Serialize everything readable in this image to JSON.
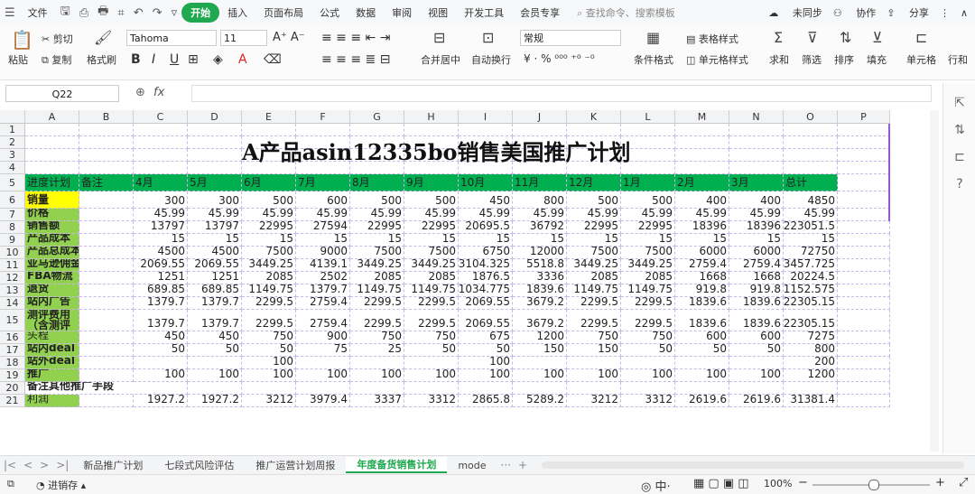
{
  "menu": {
    "file": "文件",
    "tabs": [
      "开始",
      "插入",
      "页面布局",
      "公式",
      "数据",
      "审阅",
      "视图",
      "开发工具",
      "会员专享"
    ],
    "search": "查找命令、搜索模板",
    "sync": "未同步",
    "collab": "协作",
    "share": "分享"
  },
  "ribbon": {
    "paste": "粘贴",
    "cut": "剪切",
    "copy": "复制",
    "format_painter": "格式刷",
    "font": "Tahoma",
    "size": "11",
    "merge": "合并居中",
    "wrap": "自动换行",
    "number_format": "常规",
    "cond_format": "条件格式",
    "table_style": "表格样式",
    "cell_style": "单元格样式",
    "sum": "求和",
    "filter": "筛选",
    "sort": "排序",
    "fill": "填充",
    "cell": "单元格",
    "rowcol": "行和"
  },
  "formula": {
    "name_box": "Q22",
    "fx": "fx"
  },
  "columns": [
    "A",
    "B",
    "C",
    "D",
    "E",
    "F",
    "G",
    "H",
    "I",
    "J",
    "K",
    "L",
    "M",
    "N",
    "O",
    "P"
  ],
  "rows": [
    "1",
    "2",
    "3",
    "4",
    "5",
    "6",
    "7",
    "8",
    "9",
    "10",
    "11",
    "12",
    "13",
    "14",
    "15",
    "16",
    "17",
    "18",
    "19",
    "20",
    "21"
  ],
  "sheet": {
    "title": "A产品asin12335bo销售美国推广计划",
    "header": {
      "a": "进度计划",
      "b": "备注",
      "months": [
        "4月",
        "5月",
        "6月",
        "7月",
        "8月",
        "9月",
        "10月",
        "11月",
        "12月",
        "1月",
        "2月",
        "3月"
      ],
      "total": "总计"
    },
    "sales_qty": {
      "label": "销量",
      "values": [
        "300",
        "300",
        "500",
        "600",
        "500",
        "500",
        "450",
        "800",
        "500",
        "500",
        "400",
        "400",
        "4850"
      ]
    },
    "data_rows": [
      {
        "label": "价格",
        "values": [
          "45.99",
          "45.99",
          "45.99",
          "45.99",
          "45.99",
          "45.99",
          "45.99",
          "45.99",
          "45.99",
          "45.99",
          "45.99",
          "45.99",
          "45.99"
        ]
      },
      {
        "label": "销售额",
        "values": [
          "13797",
          "13797",
          "22995",
          "27594",
          "22995",
          "22995",
          "20695.5",
          "36792",
          "22995",
          "22995",
          "18396",
          "18396",
          "223051.5"
        ]
      },
      {
        "label": "产品成本",
        "values": [
          "15",
          "15",
          "15",
          "15",
          "15",
          "15",
          "15",
          "15",
          "15",
          "15",
          "15",
          "15",
          "15"
        ]
      },
      {
        "label": "产品总成本",
        "values": [
          "4500",
          "4500",
          "7500",
          "9000",
          "7500",
          "7500",
          "6750",
          "12000",
          "7500",
          "7500",
          "6000",
          "6000",
          "72750"
        ]
      },
      {
        "label": "亚马逊佣金",
        "values": [
          "2069.55",
          "2069.55",
          "3449.25",
          "4139.1",
          "3449.25",
          "3449.25",
          "3104.325",
          "5518.8",
          "3449.25",
          "3449.25",
          "2759.4",
          "2759.4",
          "33457.725"
        ]
      },
      {
        "label": "FBA物流",
        "values": [
          "1251",
          "1251",
          "2085",
          "2502",
          "2085",
          "2085",
          "1876.5",
          "3336",
          "2085",
          "2085",
          "1668",
          "1668",
          "20224.5"
        ]
      },
      {
        "label": "退货",
        "values": [
          "689.85",
          "689.85",
          "1149.75",
          "1379.7",
          "1149.75",
          "1149.75",
          "1034.775",
          "1839.6",
          "1149.75",
          "1149.75",
          "919.8",
          "919.8",
          "11152.575"
        ]
      },
      {
        "label": "站内广告",
        "values": [
          "1379.7",
          "1379.7",
          "2299.5",
          "2759.4",
          "2299.5",
          "2299.5",
          "2069.55",
          "3679.2",
          "2299.5",
          "2299.5",
          "1839.6",
          "1839.6",
          "22305.15"
        ]
      }
    ],
    "test_fee": {
      "label1": "测评费用",
      "label2": "（含测评",
      "values": [
        "1379.7",
        "1379.7",
        "2299.5",
        "2759.4",
        "2299.5",
        "2299.5",
        "2069.55",
        "3679.2",
        "2299.5",
        "2299.5",
        "1839.6",
        "1839.6",
        "22305.15"
      ]
    },
    "head_trip": {
      "label": "头程",
      "values": [
        "450",
        "450",
        "750",
        "900",
        "750",
        "750",
        "675",
        "1200",
        "750",
        "750",
        "600",
        "600",
        "7275"
      ]
    },
    "deal_in": {
      "label": "站内deal",
      "values": [
        "50",
        "50",
        "50",
        "75",
        "25",
        "50",
        "50",
        "150",
        "150",
        "50",
        "50",
        "50",
        "800"
      ]
    },
    "deal_out": {
      "label": "站外deal",
      "values": [
        "",
        "",
        "100",
        "",
        "",
        "",
        "100",
        "",
        "",
        "",
        "",
        "",
        "200"
      ]
    },
    "promo": {
      "label": "推广",
      "values": [
        "100",
        "100",
        "100",
        "100",
        "100",
        "100",
        "100",
        "100",
        "100",
        "100",
        "100",
        "100",
        "1200"
      ]
    },
    "other": {
      "label": "备注其他推广手段"
    },
    "profit": {
      "label": "利润",
      "values": [
        "1927.2",
        "1927.2",
        "3212",
        "3979.4",
        "3337",
        "3312",
        "2865.8",
        "5289.2",
        "3212",
        "3312",
        "2619.6",
        "2619.6",
        "31381.4"
      ]
    }
  },
  "sheet_tabs": [
    "新品推广计划",
    "七段式风险评估",
    "推广运营计划周报",
    "年度备货销售计划",
    "mode"
  ],
  "status": {
    "save": "进销存",
    "zoom": "100%"
  }
}
